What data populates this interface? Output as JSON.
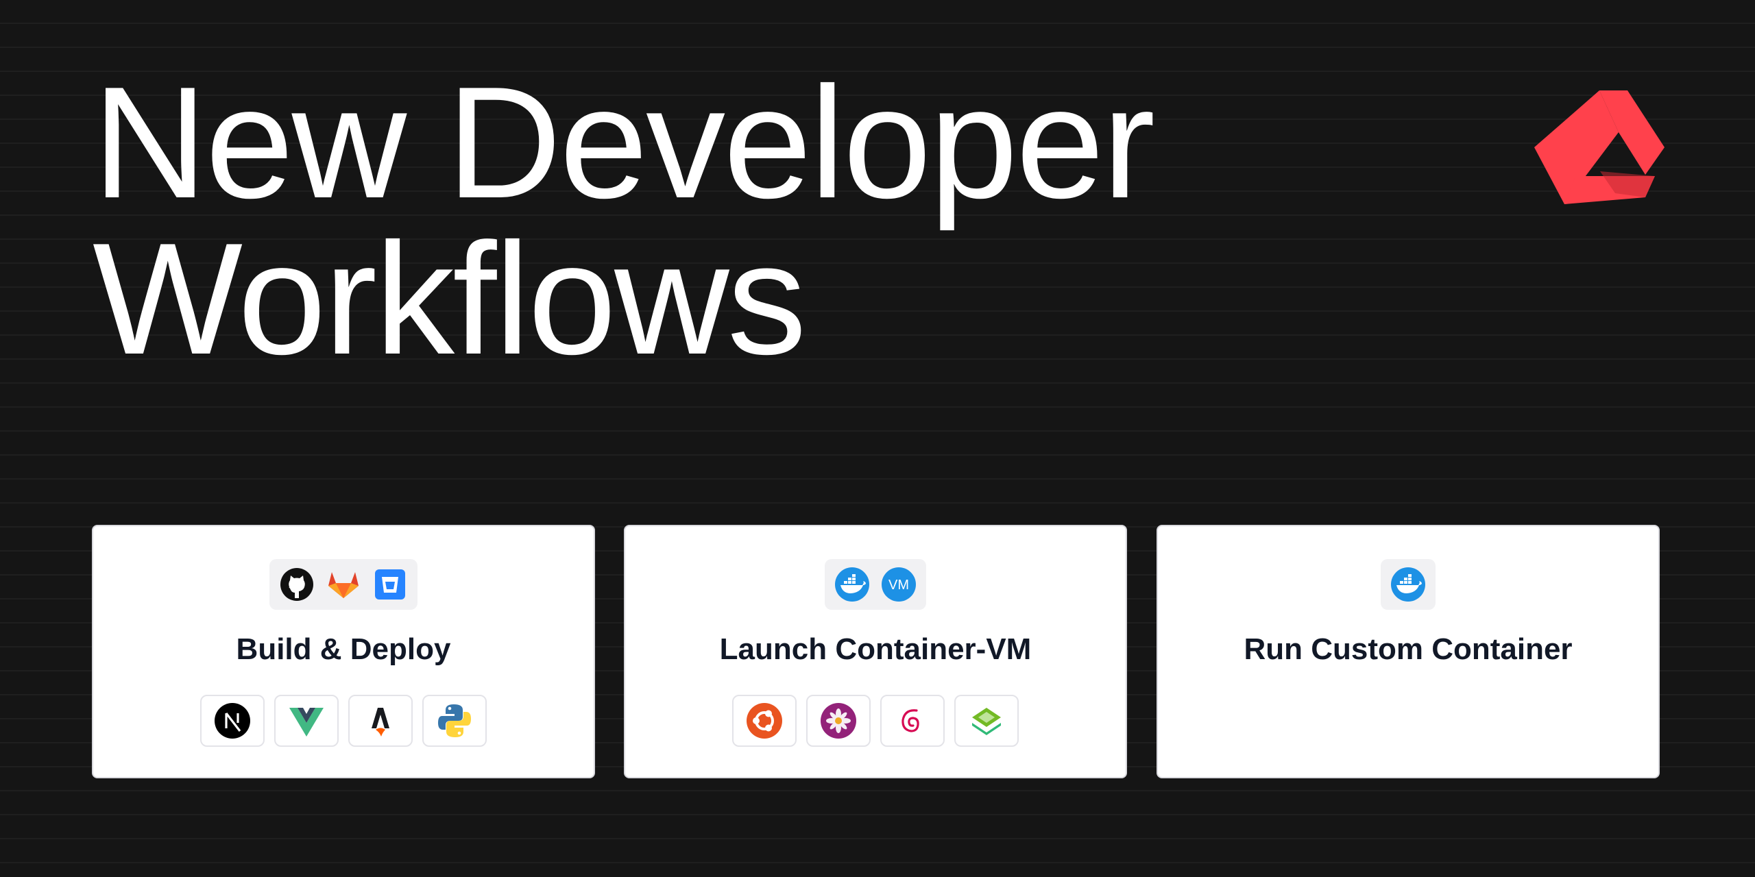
{
  "hero": {
    "line1": "New Developer",
    "line2": "Workflows"
  },
  "brand": {
    "logo": "akash-logo",
    "color": "#ff414c"
  },
  "cards": [
    {
      "title": "Build & Deploy",
      "top_icons": [
        "github-icon",
        "gitlab-icon",
        "bitbucket-icon"
      ],
      "bottom_icons": [
        "nextjs-icon",
        "vue-icon",
        "astro-icon",
        "python-icon"
      ]
    },
    {
      "title": "Launch Container-VM",
      "top_icons": [
        "docker-icon",
        "vm-icon"
      ],
      "vm_label": "VM",
      "bottom_icons": [
        "ubuntu-icon",
        "centos-icon",
        "debian-icon",
        "suse-icon"
      ]
    },
    {
      "title": "Run Custom Container",
      "top_icons": [
        "docker-icon"
      ]
    }
  ],
  "colors": {
    "background": "#151515",
    "card_background": "#ffffff",
    "title_text": "#ffffff",
    "card_title_text": "#111827",
    "docker_blue": "#1d91e5"
  }
}
